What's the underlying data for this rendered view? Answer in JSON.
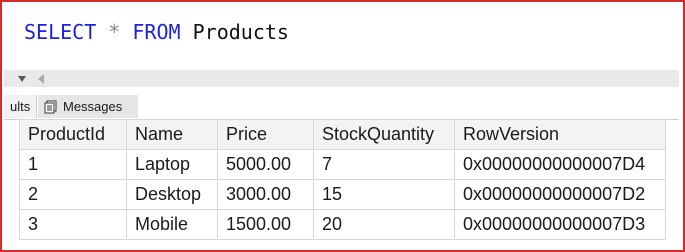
{
  "query": {
    "keyword_select": "SELECT",
    "star": "*",
    "keyword_from": "FROM",
    "table": "Products"
  },
  "tabs": {
    "results_label": "ults",
    "messages_label": "Messages"
  },
  "grid": {
    "columns": [
      "ProductId",
      "Name",
      "Price",
      "StockQuantity",
      "RowVersion"
    ],
    "rows": [
      [
        "1",
        "Laptop",
        "5000.00",
        "7",
        "0x00000000000007D4"
      ],
      [
        "2",
        "Desktop",
        "3000.00",
        "15",
        "0x00000000000007D2"
      ],
      [
        "3",
        "Mobile",
        "1500.00",
        "20",
        "0x00000000000007D3"
      ]
    ]
  },
  "colors": {
    "border": "#d62b2b",
    "keyword": "#1f23d6",
    "operator": "#8a8a8a"
  }
}
